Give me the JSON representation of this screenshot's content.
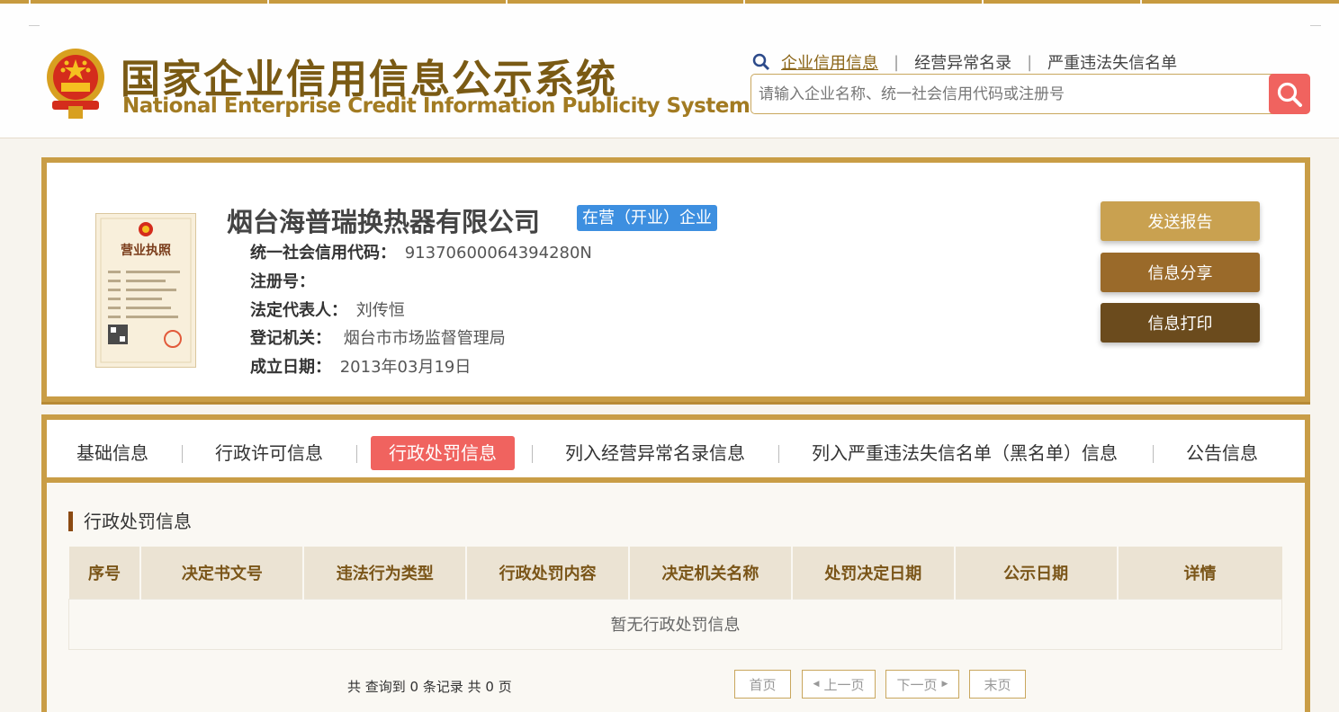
{
  "header": {
    "title_cn": "国家企业信用信息公示系统",
    "title_en": "National Enterprise Credit Information Publicity System",
    "search_icon": "magnifier-icon",
    "nav": [
      "企业信用信息",
      "经营异常名录",
      "严重违法失信名单"
    ],
    "nav_separator": "|",
    "search_placeholder": "请输入企业名称、统一社会信用代码或注册号"
  },
  "company": {
    "name": "烟台海普瑞换热器有限公司",
    "status": "在营（开业）企业",
    "credit_code_label": "统一社会信用代码：",
    "credit_code": "91370600064394280N",
    "reg_no_label": "注册号：",
    "reg_no": "",
    "legal_rep_label": "法定代表人：",
    "legal_rep": "刘传恒",
    "authority_label": "登记机关：",
    "authority": "烟台市市场监督管理局",
    "founded_label": "成立日期：",
    "founded": "2013年03月19日",
    "license_title": "营业执照"
  },
  "actions": {
    "send_report": "发送报告",
    "share": "信息分享",
    "print": "信息打印"
  },
  "tabs": [
    "基础信息",
    "行政许可信息",
    "行政处罚信息",
    "列入经营异常名录信息",
    "列入严重违法失信名单（黑名单）信息",
    "公告信息"
  ],
  "active_tab": 2,
  "section": {
    "title": "行政处罚信息",
    "columns": [
      "序号",
      "决定书文号",
      "违法行为类型",
      "行政处罚内容",
      "决定机关名称",
      "处罚决定日期",
      "公示日期",
      "详情"
    ],
    "empty_text": "暂无行政处罚信息"
  },
  "pagination": {
    "summary": "共 查询到 0 条记录 共 0 页",
    "first": "首页",
    "prev": "上一页",
    "next": "下一页",
    "last": "末页"
  },
  "colors": {
    "gold": "#c99d46",
    "accent_red": "#f0635f",
    "badge_blue": "#3d8fe0",
    "btn_send": "#c9a150",
    "btn_share": "#9a6a2a",
    "btn_print": "#6b4b1d"
  }
}
